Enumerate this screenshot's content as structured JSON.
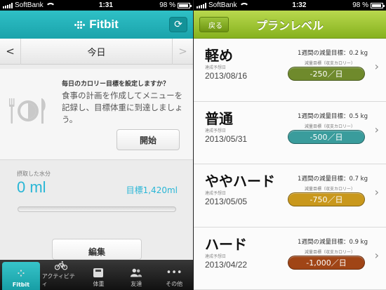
{
  "left": {
    "status": {
      "carrier": "SoftBank",
      "time": "1:31",
      "battery": "98 %"
    },
    "header": {
      "app_name": "Fitbit",
      "sync_icon": "sync-icon"
    },
    "date_bar": {
      "prev": "<",
      "title": "今日",
      "next": ">"
    },
    "calorie": {
      "question": "毎日のカロリー目標を設定しますか？",
      "description": "食事の計画を作成してメニューを記録し、目標体重に到達しましょう。",
      "start_label": "開始"
    },
    "water": {
      "label": "摂取した水分",
      "value": "0 ml",
      "goal": "目標1,420ml"
    },
    "edit_label": "編集",
    "tabs": [
      {
        "label": "Fitbit",
        "icon": "fitbit-dots-icon"
      },
      {
        "label": "アクティビティ",
        "icon": "bike-icon"
      },
      {
        "label": "体重",
        "icon": "scale-icon"
      },
      {
        "label": "友達",
        "icon": "friends-icon"
      },
      {
        "label": "その他",
        "icon": "more-icon"
      }
    ]
  },
  "right": {
    "status": {
      "carrier": "SoftBank",
      "time": "1:32",
      "battery": "98 %"
    },
    "header": {
      "back_label": "戻る",
      "title": "プランレベル"
    },
    "plans": [
      {
        "name": "軽め",
        "date_label": "達成予想日",
        "date": "2013/08/16",
        "weekly": "1週間の減量目標：0.2 kg",
        "sub_label": "減量目標（収支カロリー）",
        "calories": "-250／日",
        "color": "#6f8a2c"
      },
      {
        "name": "普通",
        "date_label": "達成予想日",
        "date": "2013/05/31",
        "weekly": "1週間の減量目標：0.5 kg",
        "sub_label": "減量目標（収支カロリー）",
        "calories": "-500／日",
        "color": "#3a9c9c"
      },
      {
        "name": "ややハード",
        "date_label": "達成予想日",
        "date": "2013/05/05",
        "weekly": "1週間の減量目標：0.7 kg",
        "sub_label": "減量目標（収支カロリー）",
        "calories": "-750／日",
        "color": "#c9981c"
      },
      {
        "name": "ハード",
        "date_label": "達成予想日",
        "date": "2013/04/22",
        "weekly": "1週間の減量目標：0.9 kg",
        "sub_label": "減量目標（収支カロリー）",
        "calories": "-1,000／日",
        "color": "#a04516"
      }
    ]
  }
}
